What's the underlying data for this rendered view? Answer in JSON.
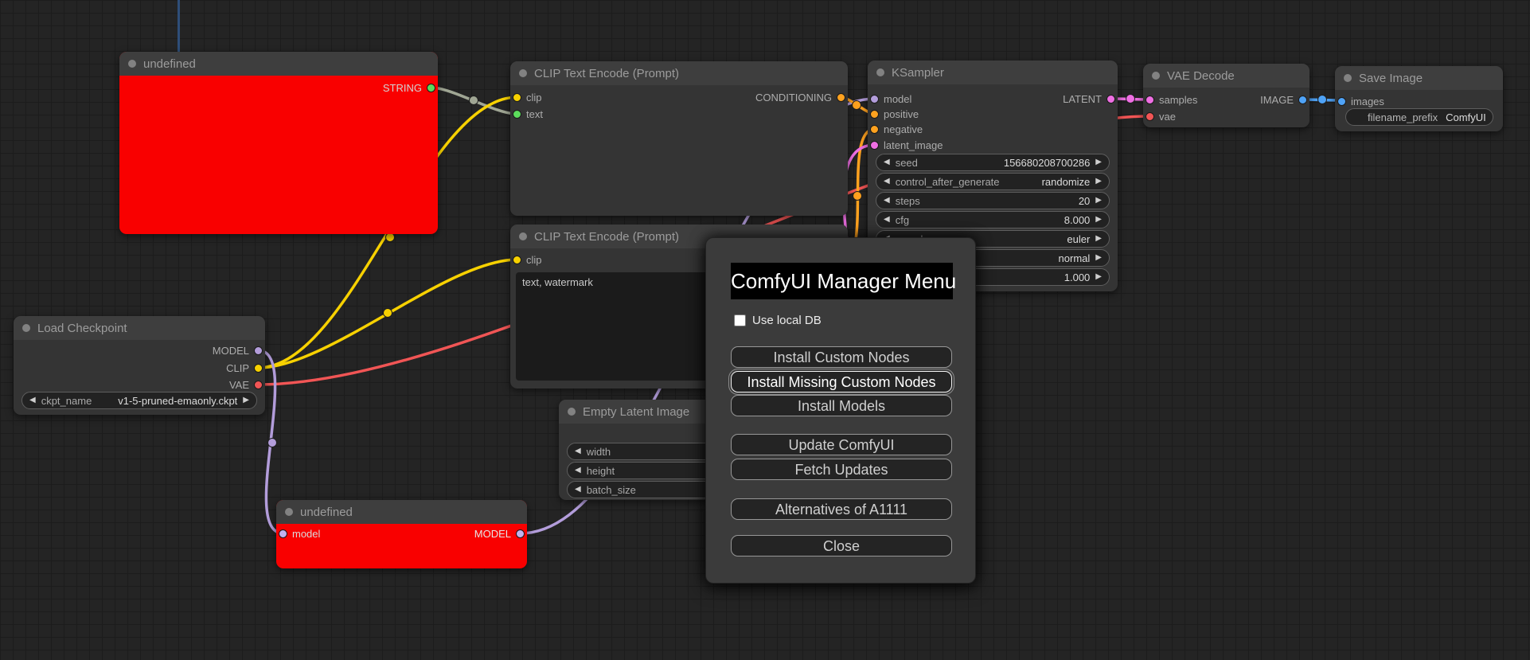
{
  "icons": {
    "stepper_left": "◀",
    "stepper_right": "▶"
  },
  "colors": {
    "canvas_bg": "#242424",
    "grid_line": "#1c1c1c",
    "node_bg": "#343434",
    "node_title_bg": "#3e3e3e",
    "node_error_bg": "#f90000",
    "dialog_bg": "#3b3b3b",
    "dialog_title_bg": "#000000",
    "wire_string_gray": "#a0a694",
    "wire_yellow": "#f7d100",
    "wire_orange": "#ffa21f",
    "wire_purple": "#b39ddb",
    "wire_pink": "#ef6fe3",
    "wire_red": "#f15555",
    "wire_blue": "#4fa3f7",
    "port_green": "#5cdc5c"
  },
  "nodes": {
    "undefined_top": {
      "title": "undefined",
      "output": "STRING"
    },
    "clip_encode_1": {
      "title": "CLIP Text Encode (Prompt)",
      "inputs": {
        "clip": "clip",
        "text": "text"
      },
      "output": "CONDITIONING"
    },
    "ksampler": {
      "title": "KSampler",
      "inputs": {
        "model": "model",
        "positive": "positive",
        "negative": "negative",
        "latent_image": "latent_image"
      },
      "output": "LATENT",
      "widgets": [
        {
          "label": "seed",
          "value": "156680208700286"
        },
        {
          "label": "control_after_generate",
          "value": "randomize"
        },
        {
          "label": "steps",
          "value": "20"
        },
        {
          "label": "cfg",
          "value": "8.000"
        },
        {
          "label": "sampler_name",
          "value": "euler"
        },
        {
          "label": "",
          "value": "normal"
        },
        {
          "label": "",
          "value": "1.000"
        }
      ]
    },
    "vae_decode": {
      "title": "VAE Decode",
      "inputs": {
        "samples": "samples",
        "vae": "vae"
      },
      "output": "IMAGE"
    },
    "save_image": {
      "title": "Save Image",
      "input": "images",
      "widget": {
        "label": "filename_prefix",
        "value": "ComfyUI"
      }
    },
    "load_checkpoint": {
      "title": "Load Checkpoint",
      "outputs": {
        "model": "MODEL",
        "clip": "CLIP",
        "vae": "VAE"
      },
      "widget": {
        "label": "ckpt_name",
        "value": "v1-5-pruned-emaonly.ckpt"
      }
    },
    "clip_encode_2": {
      "title": "CLIP Text Encode (Prompt)",
      "input": "clip",
      "prompt_text": "text, watermark"
    },
    "empty_latent": {
      "title": "Empty Latent Image",
      "widgets": [
        {
          "label": "width"
        },
        {
          "label": "height"
        },
        {
          "label": "batch_size"
        }
      ]
    },
    "undefined_bottom": {
      "title": "undefined",
      "input": "model",
      "output": "MODEL"
    }
  },
  "dialog": {
    "title": "ComfyUI Manager Menu",
    "checkbox_label": "Use local DB",
    "checkbox_checked": false,
    "buttons": [
      "Install Custom Nodes",
      "Install Missing Custom Nodes",
      "Install Models",
      "Update ComfyUI",
      "Fetch Updates",
      "Alternatives of A1111",
      "Close"
    ]
  },
  "links": [
    {
      "from": "undefined_top.STRING",
      "to": "clip_encode_1.text"
    },
    {
      "from": "load_checkpoint.CLIP",
      "to": "clip_encode_1.clip"
    },
    {
      "from": "load_checkpoint.CLIP",
      "to": "clip_encode_2.clip"
    },
    {
      "from": "load_checkpoint.VAE",
      "to": "vae_decode.vae"
    },
    {
      "from": "load_checkpoint.MODEL",
      "to": "undefined_bottom.model"
    },
    {
      "from": "undefined_bottom.MODEL",
      "to": "ksampler.model"
    },
    {
      "from": "clip_encode_1.CONDITIONING",
      "to": "ksampler.positive"
    },
    {
      "from": "clip_encode_2.CONDITIONING",
      "to": "ksampler.negative"
    },
    {
      "from": "empty_latent.LATENT",
      "to": "ksampler.latent_image"
    },
    {
      "from": "ksampler.LATENT",
      "to": "vae_decode.samples"
    },
    {
      "from": "vae_decode.IMAGE",
      "to": "save_image.images"
    }
  ]
}
